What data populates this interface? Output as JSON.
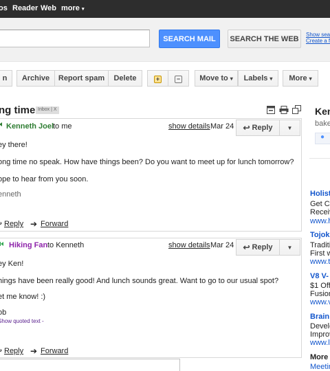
{
  "topnav": {
    "items": [
      "os",
      "Reader",
      "Web",
      "more"
    ]
  },
  "search": {
    "query": "",
    "search_mail_label": "SEARCH MAIL",
    "search_web_label": "SEARCH THE WEB",
    "show_options": "Show search",
    "create_filter": "Create a fi"
  },
  "toolbar": {
    "partial_label": "n",
    "archive": "Archive",
    "report_spam": "Report spam",
    "delete": "Delete",
    "move_to": "Move to",
    "labels": "Labels",
    "more": "More"
  },
  "conversation": {
    "subject": "ng time!",
    "label": "Inbox",
    "label_close": "| X"
  },
  "messages": [
    {
      "sender": "Kenneth Joel",
      "to": "to me",
      "show_details": "show details",
      "date": "Mar 24",
      "reply": "Reply",
      "body": [
        "ey there!",
        "ong time no speak.  How have things been?  Do you want to meet up for lunch tomorrow?",
        "ope to hear from you soon.",
        "enneth"
      ],
      "reply_link": "Reply",
      "forward_link": "Forward"
    },
    {
      "sender": "Hiking Fan",
      "to": "to Kenneth",
      "show_details": "show details",
      "date": "Mar 24",
      "reply": "Reply",
      "body": [
        "ey Ken!",
        "hings have been really good! And lunch sounds great. Want to go to our usual spot?",
        "et me know! :)",
        "ob"
      ],
      "quoted_text": "Show quoted text -",
      "reply_link": "Reply",
      "forward_link": "Forward"
    }
  ],
  "right_panel": {
    "contact_name": "Kenn",
    "contact_email": "bake",
    "ads": [
      {
        "title": "Holist",
        "lines": [
          "Get Ce",
          "Receiv"
        ],
        "url": "www.h"
      },
      {
        "title": "Tojok",
        "lines": [
          "Traditi",
          "First w"
        ],
        "url": "www.to"
      },
      {
        "title": "V8 V-",
        "lines": [
          "$1 Off",
          "Fusion"
        ],
        "url": "www.v"
      },
      {
        "title": "Brain",
        "lines": [
          "Develo",
          "Improv"
        ],
        "url": "www.lu"
      }
    ],
    "more_about": "More a",
    "meetings": "Meetin"
  },
  "colors": {
    "topbar": "#2d2d2d",
    "search_blue": "#4d90fe",
    "sender1": "#2e7d32",
    "sender2": "#8e24aa",
    "link": "#1155cc"
  }
}
